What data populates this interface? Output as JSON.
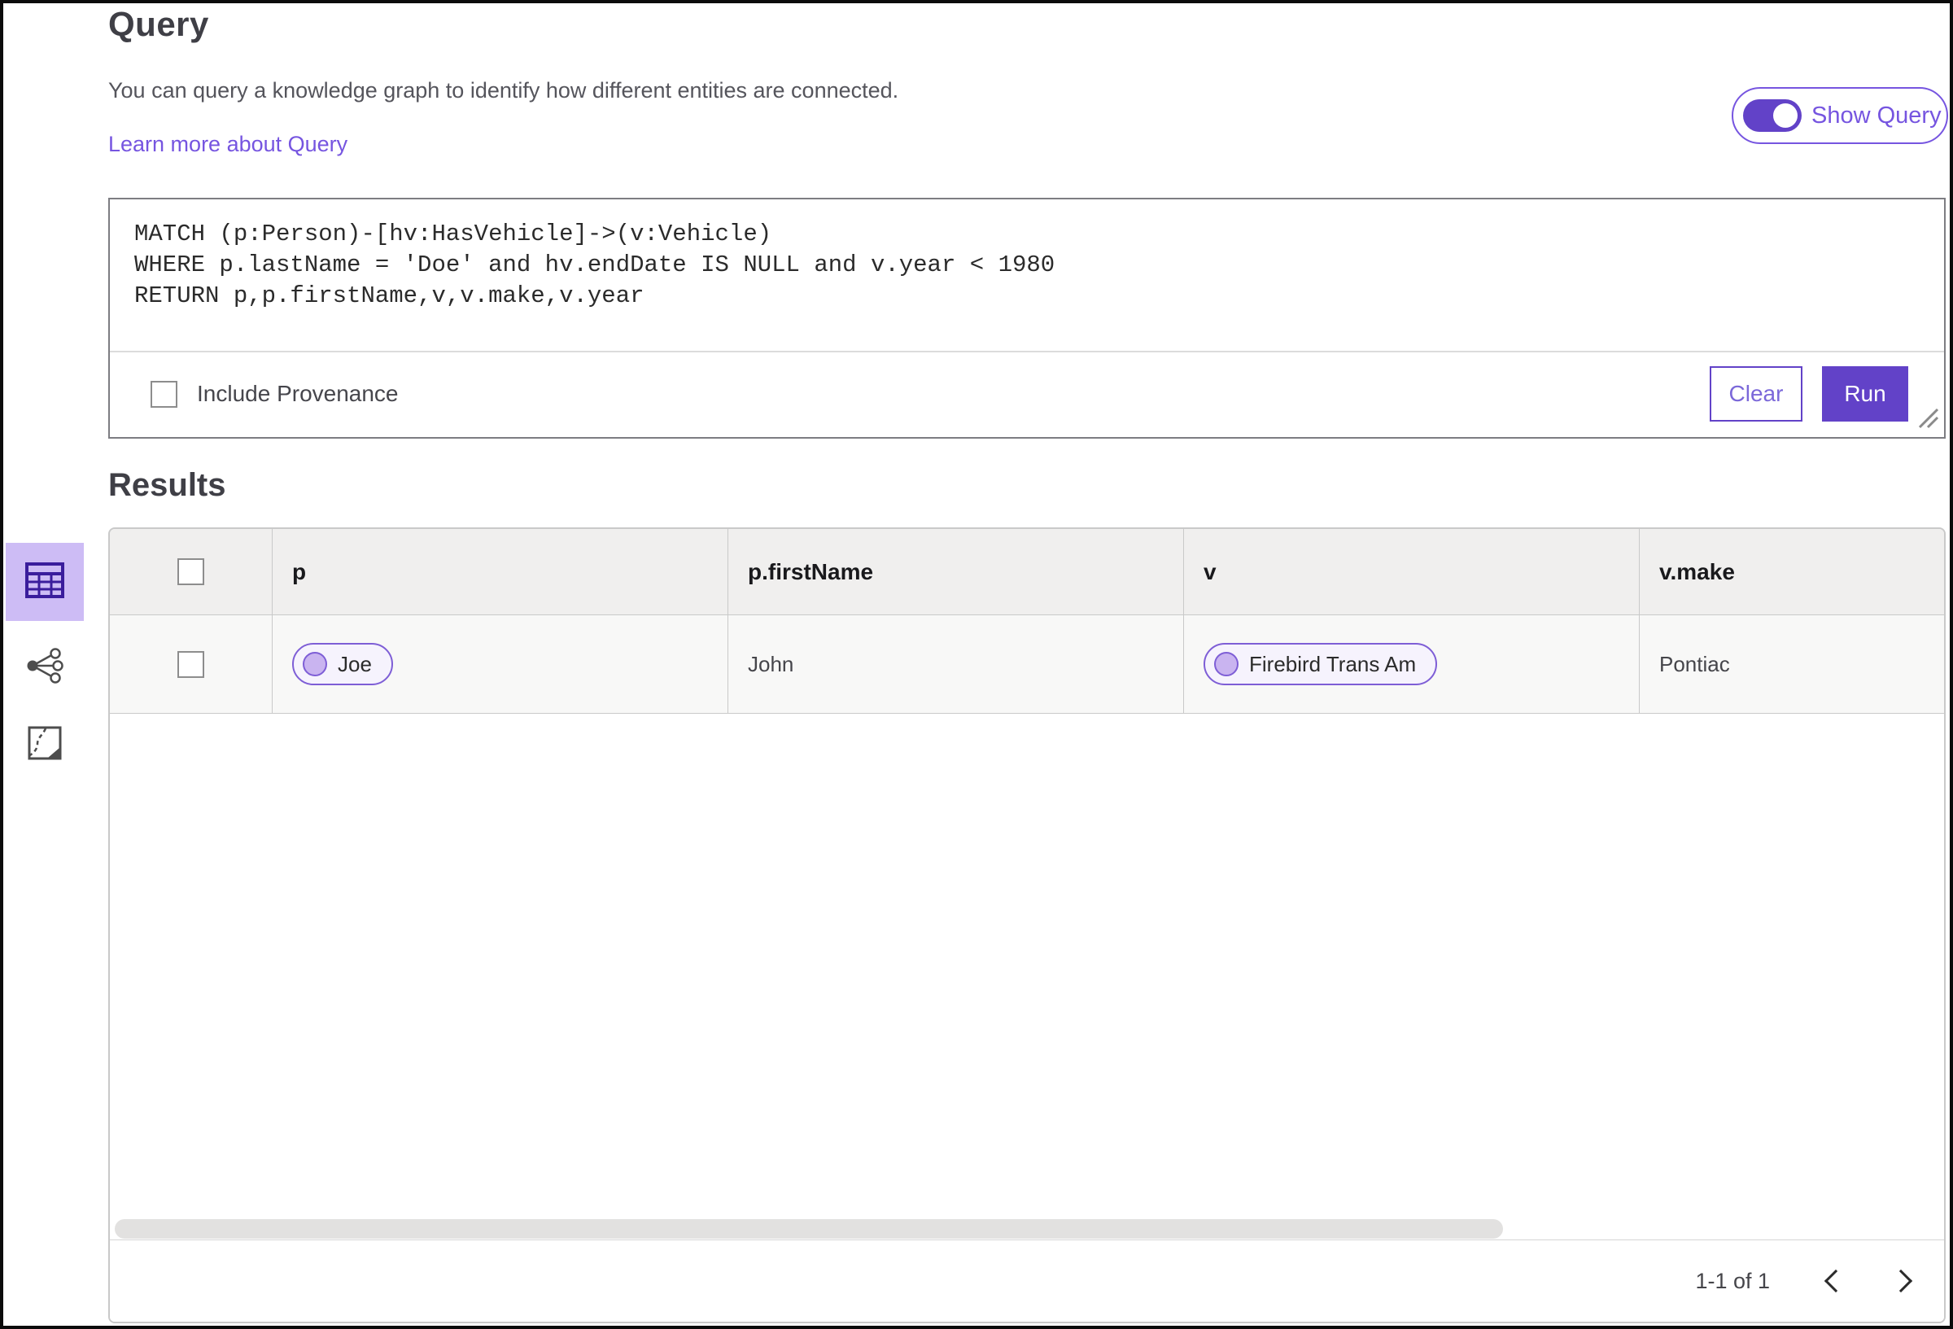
{
  "header": {
    "title": "Query",
    "description": "You can query a knowledge graph to identify how different entities are connected.",
    "learn_more_link": "Learn more about Query",
    "show_query_toggle": {
      "label": "Show Query",
      "state": "on"
    }
  },
  "query_panel": {
    "code": "MATCH (p:Person)-[hv:HasVehicle]->(v:Vehicle)\nWHERE p.lastName = 'Doe' and hv.endDate IS NULL and v.year < 1980\nRETURN p,p.firstName,v,v.make,v.year",
    "include_provenance": {
      "label": "Include Provenance",
      "checked": false
    },
    "buttons": {
      "clear": "Clear",
      "run": "Run"
    }
  },
  "results": {
    "title": "Results",
    "view_switcher": {
      "selected": "table-view",
      "options": [
        "table-view",
        "network-view",
        "map-view"
      ]
    },
    "table": {
      "columns": [
        "p",
        "p.firstName",
        "v",
        "v.make"
      ],
      "row": {
        "selected": false,
        "p_entity": "Joe",
        "firstName": "John",
        "v_entity": "Firebird Trans Am",
        "make": "Pontiac"
      }
    },
    "pagination": {
      "range_label": "1-1 of 1"
    }
  },
  "colors": {
    "accent": "#6242c8",
    "link": "#7655e0",
    "selected_view_bg": "#cdbcf5",
    "entity_pill_border": "#7e5ed6",
    "entity_pill_bg": "#f6f3fd",
    "entity_dot_fill": "#c9b4f0",
    "table_header_bg": "#f0efee",
    "table_border": "#c9c9c9"
  }
}
